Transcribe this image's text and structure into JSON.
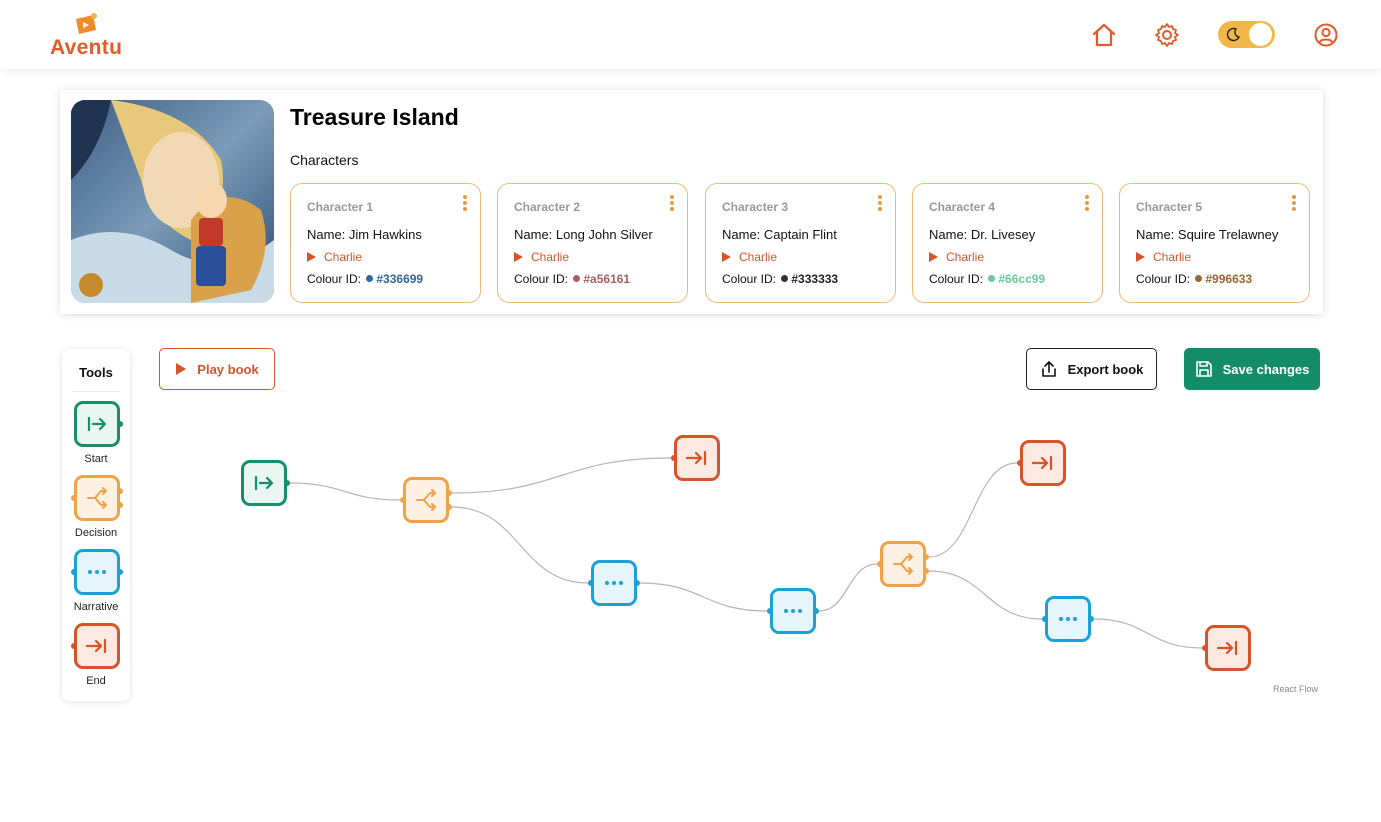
{
  "app": {
    "name": "Aventu",
    "colors": {
      "brand": "#e15a2a",
      "accent": "#f2b74b",
      "primary": "#138d68"
    }
  },
  "header": {
    "home_icon": "home-icon",
    "settings_icon": "gear-icon",
    "theme_toggle": {
      "icon": "moon-icon",
      "state": "dark-mode-off"
    },
    "profile_icon": "user-circle-icon"
  },
  "book": {
    "title": "Treasure Island",
    "characters_label": "Characters",
    "characters": [
      {
        "label": "Character 1",
        "name": "Name: Jim Hawkins",
        "voice": "Charlie",
        "colour_label": "Colour ID:",
        "colour": "#336699"
      },
      {
        "label": "Character 2",
        "name": "Name: Long John Silver",
        "voice": "Charlie",
        "colour_label": "Colour ID:",
        "colour": "#a56161"
      },
      {
        "label": "Character 3",
        "name": "Name: Captain Flint",
        "voice": "Charlie",
        "colour_label": "Colour ID:",
        "colour": "#333333"
      },
      {
        "label": "Character 4",
        "name": "Name: Dr. Livesey",
        "voice": "Charlie",
        "colour_label": "Colour ID:",
        "colour": "#66cc99"
      },
      {
        "label": "Character 5",
        "name": "Name: Squire Trelawney",
        "voice": "Charlie",
        "colour_label": "Colour ID:",
        "colour": "#996633"
      }
    ]
  },
  "tools": {
    "title": "Tools",
    "items": [
      {
        "label": "Start",
        "icon": "start-arrow-icon"
      },
      {
        "label": "Decision",
        "icon": "split-icon"
      },
      {
        "label": "Narrative",
        "icon": "ellipsis-icon"
      },
      {
        "label": "End",
        "icon": "end-arrow-icon"
      }
    ]
  },
  "toolbar": {
    "play_label": "Play book",
    "export_label": "Export book",
    "save_label": "Save changes"
  },
  "flow": {
    "nodes": [
      {
        "id": "start",
        "type": "start"
      },
      {
        "id": "dec1",
        "type": "decision"
      },
      {
        "id": "end1",
        "type": "end"
      },
      {
        "id": "nar1",
        "type": "narrative"
      },
      {
        "id": "nar2",
        "type": "narrative"
      },
      {
        "id": "dec2",
        "type": "decision"
      },
      {
        "id": "end2",
        "type": "end"
      },
      {
        "id": "nar3",
        "type": "narrative"
      },
      {
        "id": "end3",
        "type": "end"
      }
    ],
    "edges": [
      [
        "start",
        "dec1"
      ],
      [
        "dec1",
        "end1"
      ],
      [
        "dec1",
        "nar1"
      ],
      [
        "nar1",
        "nar2"
      ],
      [
        "nar2",
        "dec2"
      ],
      [
        "dec2",
        "end2"
      ],
      [
        "dec2",
        "nar3"
      ],
      [
        "nar3",
        "end3"
      ]
    ],
    "attribution": "React Flow"
  }
}
